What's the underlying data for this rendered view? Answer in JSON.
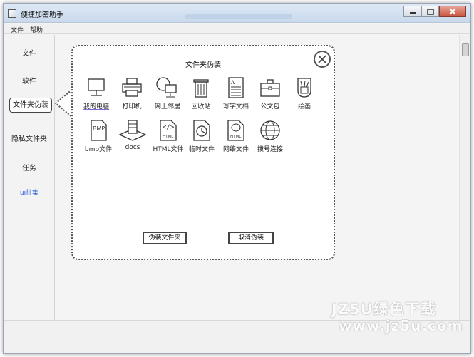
{
  "window": {
    "title": "便捷加密助手"
  },
  "menubar": {
    "items": [
      "文件",
      "帮助"
    ]
  },
  "sidebar": {
    "items": [
      "文件",
      "软件",
      "文件夹伪装",
      "隐私文件夹",
      "任务",
      "ui征集"
    ],
    "active": "文件夹伪装"
  },
  "popup": {
    "title": "文件夹伪装",
    "icons": [
      {
        "label": "我的电脑",
        "icon": "computer-icon"
      },
      {
        "label": "打印机",
        "icon": "printer-icon"
      },
      {
        "label": "网上邻居",
        "icon": "network-neighborhood-icon"
      },
      {
        "label": "回收站",
        "icon": "recycle-bin-icon"
      },
      {
        "label": "写字文档",
        "icon": "document-icon"
      },
      {
        "label": "公文包",
        "icon": "briefcase-icon"
      },
      {
        "label": "绘画",
        "icon": "paint-icon"
      },
      {
        "label": "bmp文件",
        "icon": "bmp-file-icon"
      },
      {
        "label": "docs",
        "icon": "docs-stack-icon"
      },
      {
        "label": "HTML文件",
        "icon": "html-file-icon"
      },
      {
        "label": "临时文件",
        "icon": "temp-file-icon"
      },
      {
        "label": "网络文件",
        "icon": "web-file-icon"
      },
      {
        "label": "拨号连接",
        "icon": "dialup-globe-icon"
      }
    ],
    "buttons": {
      "disguise": "伪装文件夹",
      "cancel": "取消伪装"
    }
  },
  "watermark": {
    "line1": "JZ5U绿色下载",
    "line2": "www.jz5u.com"
  }
}
